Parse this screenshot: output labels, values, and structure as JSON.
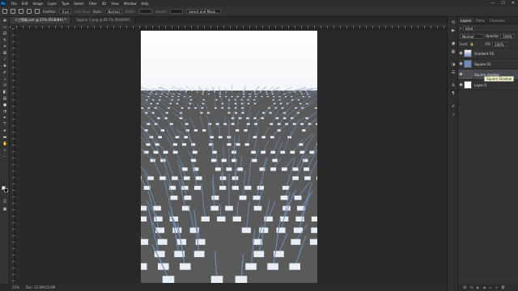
{
  "menu": {
    "logo": "Ps",
    "items": [
      "File",
      "Edit",
      "Image",
      "Layer",
      "Type",
      "Select",
      "Filter",
      "3D",
      "View",
      "Window",
      "Help"
    ],
    "window_controls": [
      "—",
      "☐",
      "✕"
    ]
  },
  "options": {
    "feather_label": "Feather:",
    "feather_value": "0 px",
    "antialias_label": "Anti-alias",
    "style_label": "Style:",
    "style_value": "Normal",
    "width_label": "Width:",
    "height_label": "Height:",
    "select_mask_label": "Select and Mask..."
  },
  "tabs": [
    {
      "label": "人工智能.psd @ 25% (RGB/8#) *"
    },
    {
      "label": "Square 1.png @ 66.7% (RGB/8#)"
    }
  ],
  "status": {
    "zoom": "25%",
    "doc": "Doc: 22.6M/22.6M"
  },
  "panel": {
    "tabs": [
      "Layers",
      "Paths",
      "Channels"
    ],
    "kind_label": "Kind",
    "blend_mode": "Normal",
    "opacity_label": "Opacity:",
    "opacity_value": "100%",
    "lock_label": "Lock:",
    "fill_label": "Fill:",
    "fill_value": "100%",
    "layers": [
      {
        "name": "Gradient Fill"
      },
      {
        "name": "Square 01"
      },
      {
        "name": "Square shadow"
      },
      {
        "name": "Layer 0"
      }
    ],
    "tooltip": "Square Shadow",
    "footer_icons": [
      "link-icon",
      "fx-icon",
      "mask-icon",
      "adjust-icon",
      "folder-icon",
      "new-layer-icon",
      "trash-icon"
    ],
    "footer_glyphs": [
      "⛓",
      "fx",
      "◐",
      "◑",
      "▭",
      "+",
      "🗑"
    ]
  },
  "colors": {
    "accent": "#31a8ff",
    "cube_light": "#e8eef6",
    "cube_blue": "#6d8db8",
    "ground": "#5a5a5a"
  }
}
